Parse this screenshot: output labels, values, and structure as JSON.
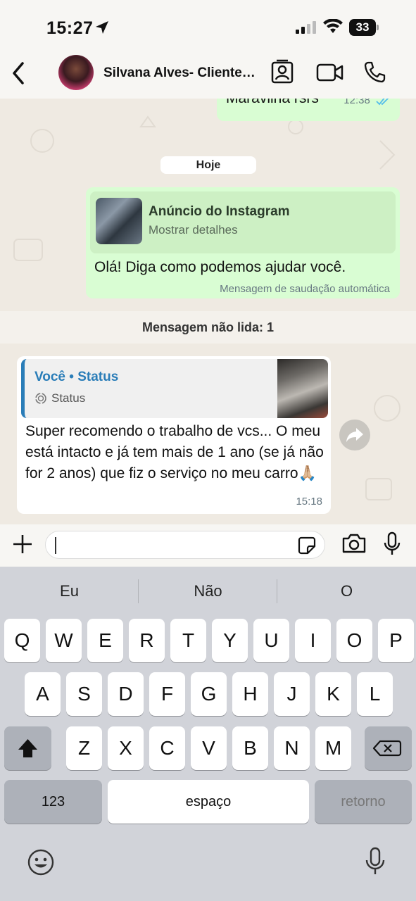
{
  "status_bar": {
    "time": "15:27",
    "battery": "33"
  },
  "header": {
    "contact_name": "Silvana Alves- Cliente…"
  },
  "messages": {
    "top": {
      "text": "Maravilha rsrs",
      "time": "12:38"
    },
    "date_label": "Hoje",
    "ad": {
      "title": "Anúncio do Instagram",
      "subtitle": "Mostrar detalhes",
      "text": "Olá! Diga como podemos ajudar você.",
      "auto_label": "Mensagem de saudação automática"
    },
    "unread_label": "Mensagem não lida: 1",
    "incoming": {
      "reply_title": "Você • Status",
      "reply_sub": "Status",
      "text": "Super recomendo o trabalho de vcs... O meu está intacto e já tem mais de 1 ano (se já não for 2 anos) que fiz o serviço no meu carro🙏🏼",
      "time": "15:18"
    }
  },
  "input": {
    "value": ""
  },
  "keyboard": {
    "suggestions": [
      "Eu",
      "Não",
      "O"
    ],
    "row1": [
      "Q",
      "W",
      "E",
      "R",
      "T",
      "Y",
      "U",
      "I",
      "O",
      "P"
    ],
    "row2": [
      "A",
      "S",
      "D",
      "F",
      "G",
      "H",
      "J",
      "K",
      "L"
    ],
    "row3": [
      "Z",
      "X",
      "C",
      "V",
      "B",
      "N",
      "M"
    ],
    "numbers_label": "123",
    "space_label": "espaço",
    "return_label": "retorno"
  },
  "colors": {
    "outgoing_bubble": "#d9fdd3",
    "incoming_bubble": "#ffffff",
    "reply_accent": "#2a7db8",
    "read_ticks": "#53bdeb"
  },
  "icons": [
    "location-arrow-icon",
    "cellular-signal-icon",
    "wifi-icon",
    "battery-icon",
    "back-chevron-icon",
    "contact-card-icon",
    "video-call-icon",
    "phone-icon",
    "double-check-icon",
    "status-icon",
    "forward-icon",
    "plus-icon",
    "sticker-icon",
    "camera-icon",
    "microphone-icon",
    "shift-icon",
    "backspace-icon",
    "emoji-icon",
    "dictation-icon"
  ]
}
